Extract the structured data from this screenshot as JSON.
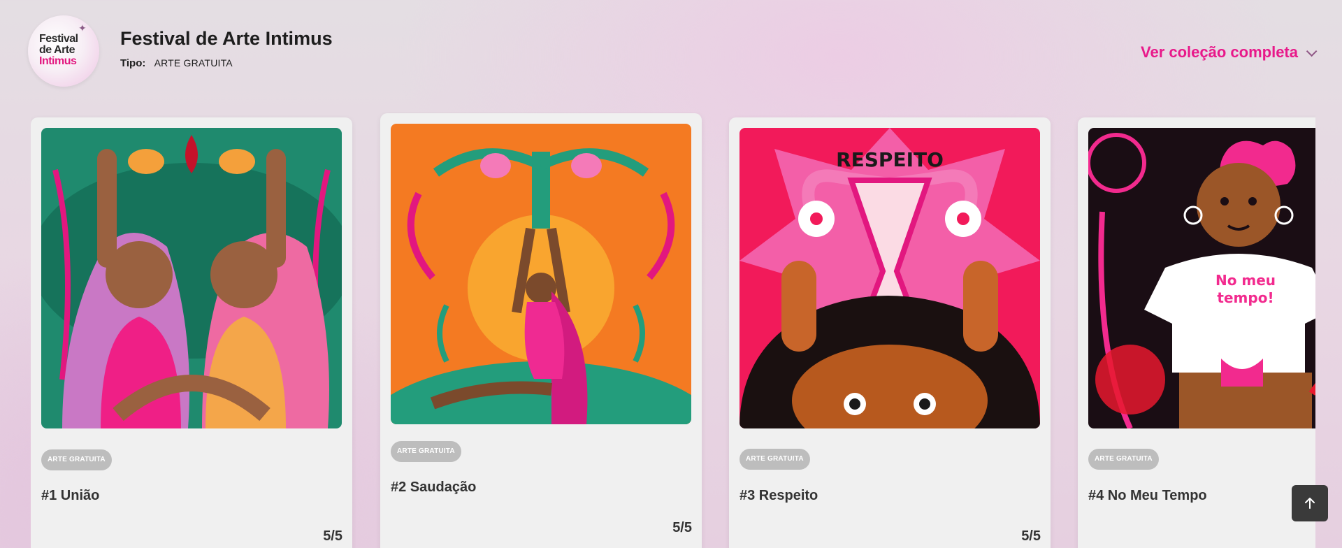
{
  "header": {
    "logo": {
      "line1": "Festival",
      "line2": "de Arte",
      "line3": "Intimus"
    },
    "title": "Festival de Arte Intimus",
    "type_label": "Tipo:",
    "type_value": "ARTE GRATUITA",
    "view_all_label": "Ver coleção completa",
    "view_all_icon": "chevron-down-icon",
    "brand_color": "#e8198a"
  },
  "cards": [
    {
      "badge": "ARTE GRATUITA",
      "title": "#1 União",
      "rating": "5/5"
    },
    {
      "badge": "ARTE GRATUITA",
      "title": "#2 Saudação",
      "rating": "5/5"
    },
    {
      "badge": "ARTE GRATUITA",
      "title": "#3 Respeito",
      "rating": "5/5"
    },
    {
      "badge": "ARTE GRATUITA",
      "title": "#4 No Meu Tempo",
      "rating": ""
    }
  ],
  "art_text": {
    "card3": "RESPEITO",
    "card4_line1": "No meu",
    "card4_line2": "tempo!"
  },
  "scroll_top_icon": "arrow-up-icon"
}
